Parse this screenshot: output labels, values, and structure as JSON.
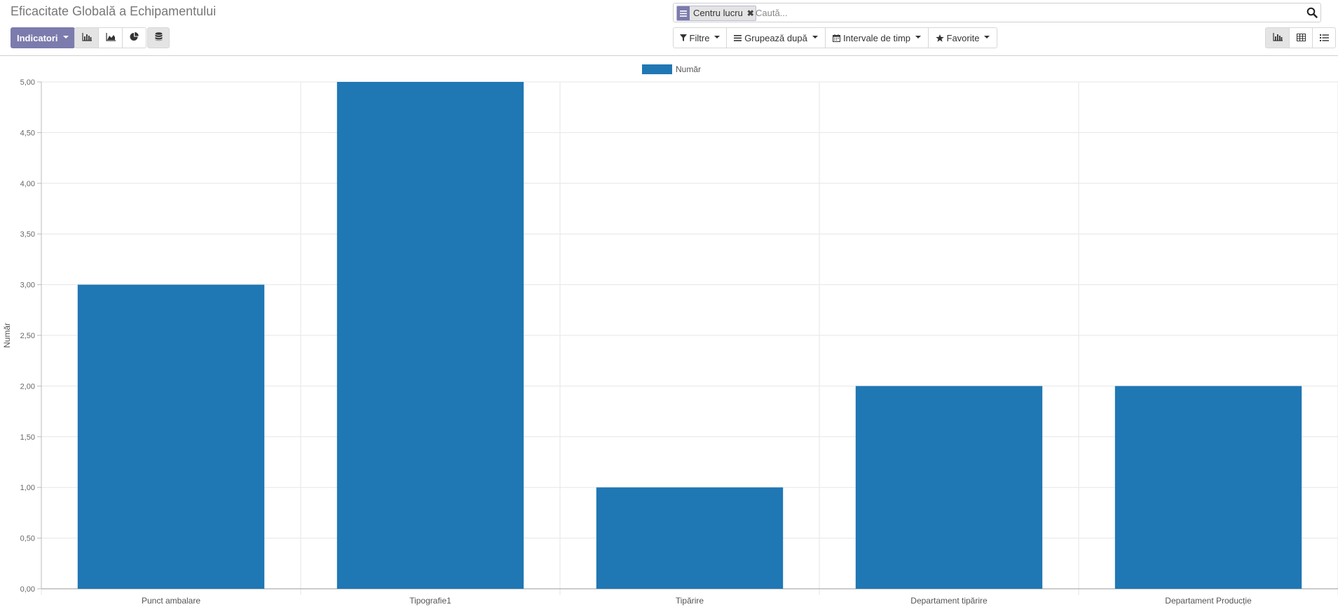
{
  "page": {
    "title": "Eficacitate Globală a Echipamentului"
  },
  "toolbar": {
    "measures_label": "Indicatori",
    "chart_buttons": [
      {
        "name": "bar-chart",
        "active": true
      },
      {
        "name": "line-chart",
        "active": false
      },
      {
        "name": "pie-chart",
        "active": false
      },
      {
        "name": "stacked",
        "active": true
      }
    ]
  },
  "search": {
    "facet_label": "Centru lucru",
    "placeholder": "Caută..."
  },
  "filters": {
    "filters_label": "Filtre",
    "groupby_label": "Grupează după",
    "timeranges_label": "Intervale de timp",
    "favorites_label": "Favorite"
  },
  "views": [
    {
      "name": "graph",
      "active": true
    },
    {
      "name": "pivot",
      "active": false
    },
    {
      "name": "list",
      "active": false
    }
  ],
  "colors": {
    "accent": "#7c7bad",
    "bar": "#1f77b4",
    "grid": "#e6e6e6"
  },
  "chart_data": {
    "type": "bar",
    "categories": [
      "Punct ambalare",
      "Tipografie1",
      "Tipărire",
      "Departament tipărire",
      "Departament Producție"
    ],
    "series": [
      {
        "name": "Număr",
        "values": [
          3,
          5,
          1,
          2,
          2
        ]
      }
    ],
    "ylabel": "Număr",
    "xlabel": "",
    "ylim": [
      0,
      5
    ],
    "yticks": [
      "0,00",
      "0,50",
      "1,00",
      "1,50",
      "2,00",
      "2,50",
      "3,00",
      "3,50",
      "4,00",
      "4,50",
      "5,00"
    ],
    "grid": true,
    "legend": "top-center"
  }
}
